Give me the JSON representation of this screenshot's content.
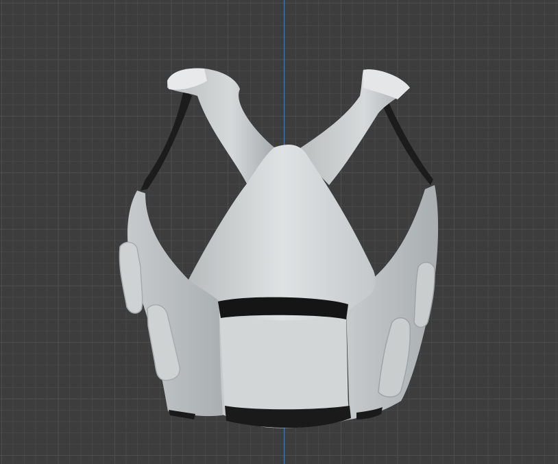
{
  "viewport": {
    "background_color": "#3d3d3d",
    "grid_minor_color": "#474747",
    "grid_major_color": "#4e4e4e",
    "z_axis_color": "#4a73b8",
    "grid_visible": true
  },
  "object": {
    "name": "vest mesh",
    "shading": "solid",
    "base_color": "#c8cccd",
    "strap_color": "#1a1a1a",
    "pocket_count": 4,
    "band_count": 2
  }
}
